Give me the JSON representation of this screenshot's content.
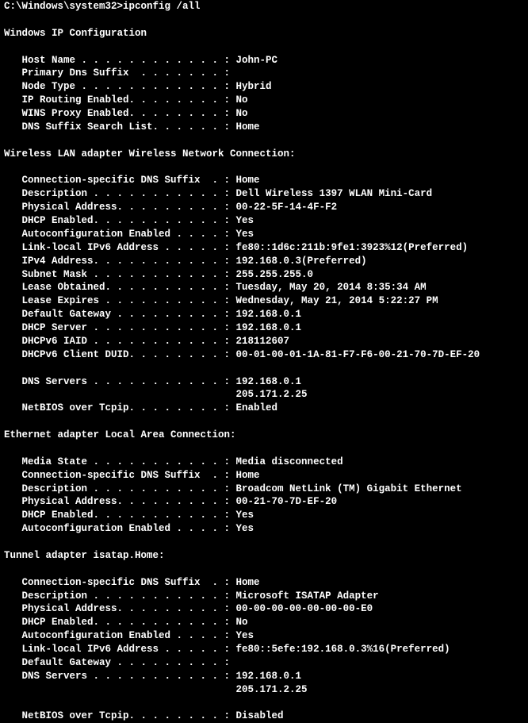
{
  "prompt": "C:\\Windows\\system32>ipconfig /all",
  "title": "Windows IP Configuration",
  "main": {
    "host_name_line": "   Host Name . . . . . . . . . . . . : John-PC",
    "primary_dns_line": "   Primary Dns Suffix  . . . . . . . :",
    "node_type_line": "   Node Type . . . . . . . . . . . . : Hybrid",
    "ip_routing_line": "   IP Routing Enabled. . . . . . . . : No",
    "wins_proxy_line": "   WINS Proxy Enabled. . . . . . . . : No",
    "dns_suffix_list_line": "   DNS Suffix Search List. . . . . . : Home"
  },
  "wlan_header": "Wireless LAN adapter Wireless Network Connection:",
  "wlan": {
    "conn_dns_line": "   Connection-specific DNS Suffix  . : Home",
    "desc_line": "   Description . . . . . . . . . . . : Dell Wireless 1397 WLAN Mini-Card",
    "phys_addr_line": "   Physical Address. . . . . . . . . : 00-22-5F-14-4F-F2",
    "dhcp_line": "   DHCP Enabled. . . . . . . . . . . : Yes",
    "autoconf_line": "   Autoconfiguration Enabled . . . . : Yes",
    "link_local_line": "   Link-local IPv6 Address . . . . . : fe80::1d6c:211b:9fe1:3923%12(Preferred)",
    "ipv4_line": "   IPv4 Address. . . . . . . . . . . : 192.168.0.3(Preferred)",
    "subnet_line": "   Subnet Mask . . . . . . . . . . . : 255.255.255.0",
    "lease_obt_line": "   Lease Obtained. . . . . . . . . . : Tuesday, May 20, 2014 8:35:34 AM",
    "lease_exp_line": "   Lease Expires . . . . . . . . . . : Wednesday, May 21, 2014 5:22:27 PM",
    "gateway_line": "   Default Gateway . . . . . . . . . : 192.168.0.1",
    "dhcp_srv_line": "   DHCP Server . . . . . . . . . . . : 192.168.0.1",
    "dhcpv6_iaid_line": "   DHCPv6 IAID . . . . . . . . . . . : 218112607",
    "dhcpv6_duid_line": "   DHCPv6 Client DUID. . . . . . . . : 00-01-00-01-1A-81-F7-F6-00-21-70-7D-EF-20",
    "dns1_line": "   DNS Servers . . . . . . . . . . . : 192.168.0.1",
    "dns2_line": "                                       205.171.2.25",
    "netbios_line": "   NetBIOS over Tcpip. . . . . . . . : Enabled"
  },
  "eth_header": "Ethernet adapter Local Area Connection:",
  "eth": {
    "media_state_line": "   Media State . . . . . . . . . . . : Media disconnected",
    "conn_dns_line": "   Connection-specific DNS Suffix  . : Home",
    "desc_line": "   Description . . . . . . . . . . . : Broadcom NetLink (TM) Gigabit Ethernet",
    "phys_addr_line": "   Physical Address. . . . . . . . . : 00-21-70-7D-EF-20",
    "dhcp_line": "   DHCP Enabled. . . . . . . . . . . : Yes",
    "autoconf_line": "   Autoconfiguration Enabled . . . . : Yes"
  },
  "tunnel_header": "Tunnel adapter isatap.Home:",
  "tunnel": {
    "conn_dns_line": "   Connection-specific DNS Suffix  . : Home",
    "desc_line": "   Description . . . . . . . . . . . : Microsoft ISATAP Adapter",
    "phys_addr_line": "   Physical Address. . . . . . . . . : 00-00-00-00-00-00-00-E0",
    "dhcp_line": "   DHCP Enabled. . . . . . . . . . . : No",
    "autoconf_line": "   Autoconfiguration Enabled . . . . : Yes",
    "link_local_line": "   Link-local IPv6 Address . . . . . : fe80::5efe:192.168.0.3%16(Preferred)",
    "gateway_line": "   Default Gateway . . . . . . . . . :",
    "dns1_line": "   DNS Servers . . . . . . . . . . . : 192.168.0.1",
    "dns2_line": "                                       205.171.2.25",
    "netbios_line": "   NetBIOS over Tcpip. . . . . . . . : Disabled"
  }
}
